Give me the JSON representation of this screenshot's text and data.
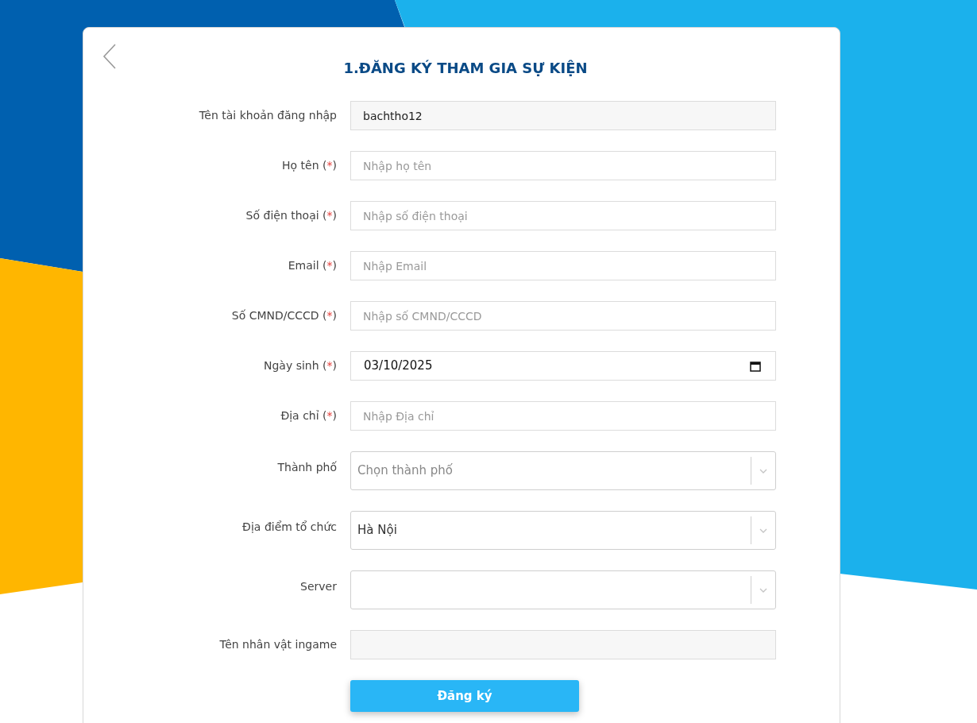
{
  "form": {
    "title": "1.ĐĂNG KÝ THAM GIA SỰ KIỆN",
    "required_mark": "(*)",
    "fields": [
      {
        "kind": "readonly",
        "label": "Tên tài khoản đăng nhập",
        "required": false,
        "value": "bachtho12"
      },
      {
        "kind": "text",
        "label": "Họ tên",
        "required": true,
        "placeholder": "Nhập họ tên"
      },
      {
        "kind": "text",
        "label": "Số điện thoại",
        "required": true,
        "placeholder": "Nhập số điện thoại"
      },
      {
        "kind": "text",
        "label": "Email",
        "required": true,
        "placeholder": "Nhập Email"
      },
      {
        "kind": "text",
        "label": "Số CMND/CCCD",
        "required": true,
        "placeholder": "Nhập số CMND/CCCD"
      },
      {
        "kind": "date",
        "label": "Ngày sinh",
        "required": true,
        "value": "03/10/2025"
      },
      {
        "kind": "text",
        "label": "Địa chỉ",
        "required": true,
        "placeholder": "Nhập Địa chỉ"
      },
      {
        "kind": "select",
        "label": "Thành phố",
        "required": false,
        "placeholder": "Chọn thành phố"
      },
      {
        "kind": "select",
        "label": "Địa điểm tổ chức",
        "required": false,
        "value": "Hà Nội"
      },
      {
        "kind": "select",
        "label": "Server",
        "required": false
      },
      {
        "kind": "readonly",
        "label": "Tên nhân vật ingame",
        "required": false
      }
    ],
    "submit": "Đăng ký"
  }
}
